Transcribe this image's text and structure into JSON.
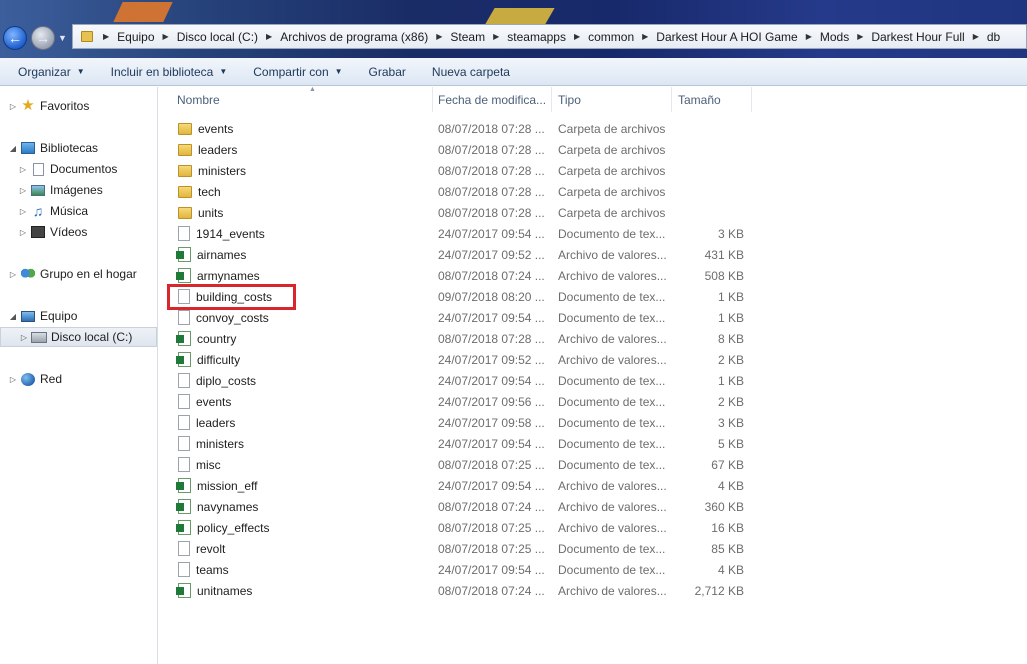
{
  "address": {
    "crumbs": [
      "Equipo",
      "Disco local (C:)",
      "Archivos de programa (x86)",
      "Steam",
      "steamapps",
      "common",
      "Darkest Hour A HOI Game",
      "Mods",
      "Darkest Hour Full",
      "db"
    ]
  },
  "toolbar": {
    "organize": "Organizar",
    "include_library": "Incluir en biblioteca",
    "share": "Compartir con",
    "burn": "Grabar",
    "new_folder": "Nueva carpeta"
  },
  "nav": {
    "favorites": "Favoritos",
    "libraries": "Bibliotecas",
    "documents": "Documentos",
    "images": "Imágenes",
    "music": "Música",
    "videos": "Vídeos",
    "homegroup": "Grupo en el hogar",
    "computer": "Equipo",
    "local_disk": "Disco local (C:)",
    "network": "Red"
  },
  "columns": {
    "name": "Nombre",
    "date": "Fecha de modifica...",
    "type": "Tipo",
    "size": "Tamaño"
  },
  "files": [
    {
      "name": "events",
      "date": "08/07/2018 07:28 ...",
      "type": "Carpeta de archivos",
      "size": "",
      "icon": "folder-icon"
    },
    {
      "name": "leaders",
      "date": "08/07/2018 07:28 ...",
      "type": "Carpeta de archivos",
      "size": "",
      "icon": "folder-icon"
    },
    {
      "name": "ministers",
      "date": "08/07/2018 07:28 ...",
      "type": "Carpeta de archivos",
      "size": "",
      "icon": "folder-icon"
    },
    {
      "name": "tech",
      "date": "08/07/2018 07:28 ...",
      "type": "Carpeta de archivos",
      "size": "",
      "icon": "folder-icon"
    },
    {
      "name": "units",
      "date": "08/07/2018 07:28 ...",
      "type": "Carpeta de archivos",
      "size": "",
      "icon": "folder-icon"
    },
    {
      "name": "1914_events",
      "date": "24/07/2017 09:54 ...",
      "type": "Documento de tex...",
      "size": "3 KB",
      "icon": "text-file-icon"
    },
    {
      "name": "airnames",
      "date": "24/07/2017 09:52 ...",
      "type": "Archivo de valores...",
      "size": "431 KB",
      "icon": "csv-file-icon"
    },
    {
      "name": "armynames",
      "date": "08/07/2018 07:24 ...",
      "type": "Archivo de valores...",
      "size": "508 KB",
      "icon": "csv-file-icon"
    },
    {
      "name": "building_costs",
      "date": "09/07/2018 08:20 ...",
      "type": "Documento de tex...",
      "size": "1 KB",
      "icon": "text-file-icon"
    },
    {
      "name": "convoy_costs",
      "date": "24/07/2017 09:54 ...",
      "type": "Documento de tex...",
      "size": "1 KB",
      "icon": "text-file-icon"
    },
    {
      "name": "country",
      "date": "08/07/2018 07:28 ...",
      "type": "Archivo de valores...",
      "size": "8 KB",
      "icon": "csv-file-icon"
    },
    {
      "name": "difficulty",
      "date": "24/07/2017 09:52 ...",
      "type": "Archivo de valores...",
      "size": "2 KB",
      "icon": "csv-file-icon"
    },
    {
      "name": "diplo_costs",
      "date": "24/07/2017 09:54 ...",
      "type": "Documento de tex...",
      "size": "1 KB",
      "icon": "text-file-icon"
    },
    {
      "name": "events",
      "date": "24/07/2017 09:56 ...",
      "type": "Documento de tex...",
      "size": "2 KB",
      "icon": "text-file-icon"
    },
    {
      "name": "leaders",
      "date": "24/07/2017 09:58 ...",
      "type": "Documento de tex...",
      "size": "3 KB",
      "icon": "text-file-icon"
    },
    {
      "name": "ministers",
      "date": "24/07/2017 09:54 ...",
      "type": "Documento de tex...",
      "size": "5 KB",
      "icon": "text-file-icon"
    },
    {
      "name": "misc",
      "date": "08/07/2018 07:25 ...",
      "type": "Documento de tex...",
      "size": "67 KB",
      "icon": "text-file-icon"
    },
    {
      "name": "mission_eff",
      "date": "24/07/2017 09:54 ...",
      "type": "Archivo de valores...",
      "size": "4 KB",
      "icon": "csv-file-icon"
    },
    {
      "name": "navynames",
      "date": "08/07/2018 07:24 ...",
      "type": "Archivo de valores...",
      "size": "360 KB",
      "icon": "csv-file-icon"
    },
    {
      "name": "policy_effects",
      "date": "08/07/2018 07:25 ...",
      "type": "Archivo de valores...",
      "size": "16 KB",
      "icon": "csv-file-icon"
    },
    {
      "name": "revolt",
      "date": "08/07/2018 07:25 ...",
      "type": "Documento de tex...",
      "size": "85 KB",
      "icon": "text-file-icon"
    },
    {
      "name": "teams",
      "date": "24/07/2017 09:54 ...",
      "type": "Documento de tex...",
      "size": "4 KB",
      "icon": "text-file-icon"
    },
    {
      "name": "unitnames",
      "date": "08/07/2018 07:24 ...",
      "type": "Archivo de valores...",
      "size": "2,712 KB",
      "icon": "csv-file-icon"
    }
  ],
  "highlighted_file": "building_costs",
  "colors": {
    "highlight": "#d9262c",
    "toolbar_text": "#1e395b"
  }
}
